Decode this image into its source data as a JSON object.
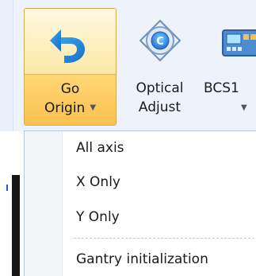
{
  "ribbon": {
    "go_origin": {
      "line1": "Go",
      "line2": "Origin",
      "has_dropdown": true,
      "icon": "undo-arrow-icon",
      "state": "pressed"
    },
    "optical_adjust": {
      "line1": "Optical",
      "line2": "Adjust",
      "icon": "crosshair-c-icon"
    },
    "bcs": {
      "line1": "BCS1",
      "has_dropdown": true,
      "icon": "controller-panel-icon"
    }
  },
  "menu": {
    "items": [
      {
        "label": "All axis"
      },
      {
        "label": "X Only"
      },
      {
        "label": "Y Only"
      },
      {
        "label": "Gantry initialization"
      }
    ]
  },
  "colors": {
    "accent_blue": "#1f88d6",
    "pressed_top": "#fce7a6",
    "pressed_bottom": "#fbc04f",
    "pressed_border": "#d3ad4b"
  }
}
